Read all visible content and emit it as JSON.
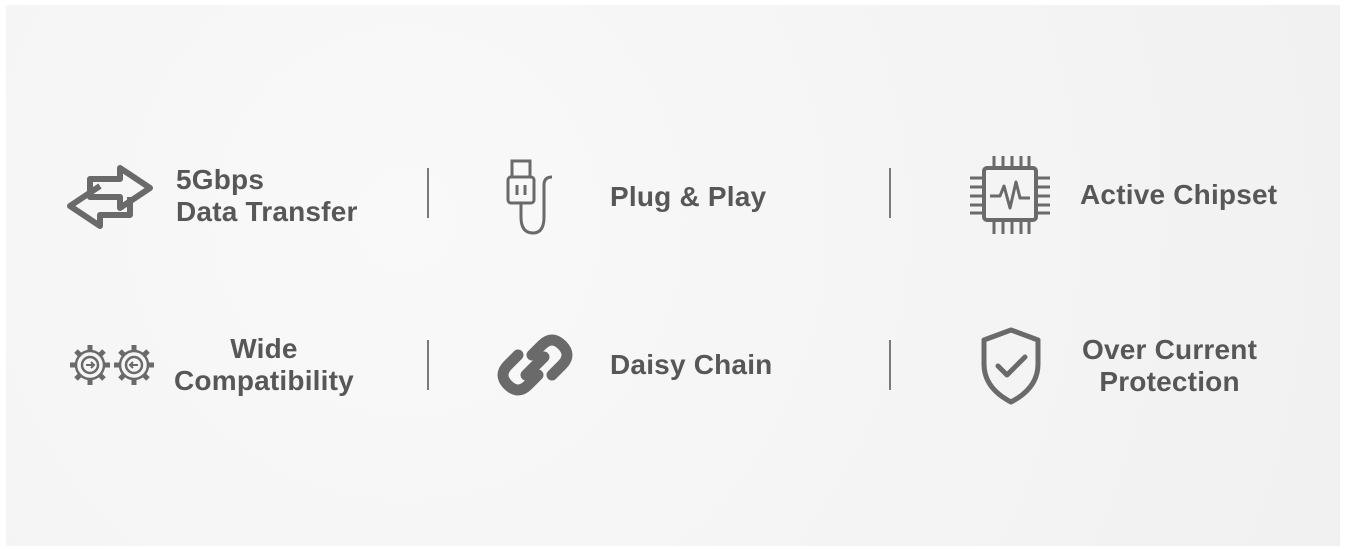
{
  "colors": {
    "background": "#f3f3f3",
    "icon": "#6a6a6a",
    "text": "#575757",
    "divider": "#7a7a7a"
  },
  "features": [
    {
      "id": "data-transfer",
      "icon": "bidirectional-arrows-icon",
      "lines": [
        "5Gbps",
        "Data Transfer"
      ]
    },
    {
      "id": "plug-and-play",
      "icon": "usb-cable-icon",
      "lines": [
        "Plug & Play"
      ]
    },
    {
      "id": "active-chipset",
      "icon": "chipset-icon",
      "lines": [
        "Active Chipset"
      ]
    },
    {
      "id": "wide-compatibility",
      "icon": "gears-icon",
      "lines": [
        "Wide",
        "Compatibility"
      ]
    },
    {
      "id": "daisy-chain",
      "icon": "chain-link-icon",
      "lines": [
        "Daisy Chain"
      ]
    },
    {
      "id": "over-current-protection",
      "icon": "shield-check-icon",
      "lines": [
        "Over Current",
        "Protection"
      ]
    }
  ]
}
